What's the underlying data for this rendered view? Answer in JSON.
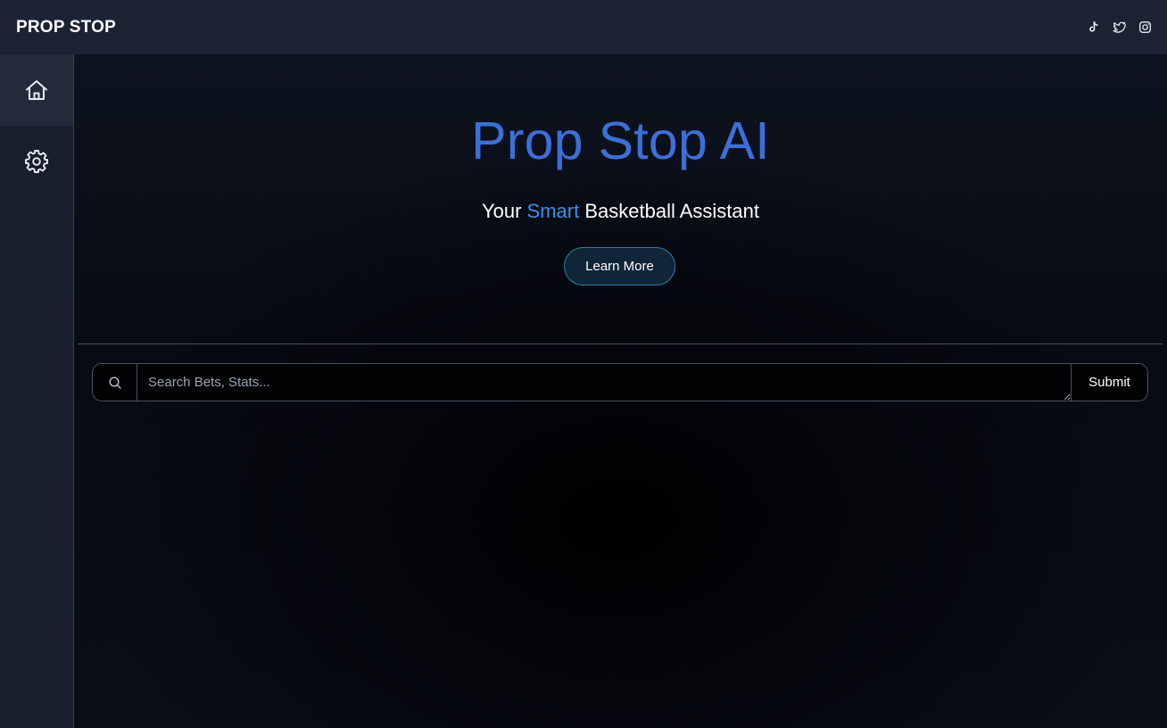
{
  "header": {
    "brand": "PROP STOP",
    "socials": [
      {
        "icon": "tiktok-icon"
      },
      {
        "icon": "twitter-icon"
      },
      {
        "icon": "instagram-icon"
      }
    ]
  },
  "sidebar": {
    "items": [
      {
        "icon": "home-icon",
        "active": true
      },
      {
        "icon": "gear-icon",
        "active": false
      }
    ]
  },
  "hero": {
    "title": "Prop Stop AI",
    "subtitle_before": "Your ",
    "subtitle_accent": "Smart",
    "subtitle_after": " Basketball Assistant",
    "cta_label": "Learn More"
  },
  "search": {
    "placeholder": "Search Bets, Stats...",
    "value": "",
    "submit_label": "Submit"
  },
  "colors": {
    "accent": "#3b6fd9",
    "accent_light": "#3d8fe6",
    "topbar": "#1c2333",
    "sidebar": "#181e2c"
  }
}
